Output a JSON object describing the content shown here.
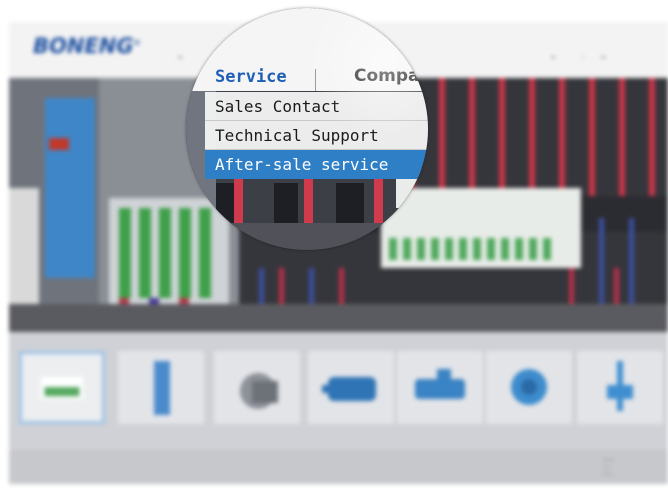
{
  "site": {
    "logo_text": "BONENG",
    "logo_mark": "®",
    "brand_color": "#1d4fa1"
  },
  "header": {
    "nav_service": "Service",
    "nav_company": "Company"
  },
  "dropdown": {
    "items": [
      {
        "label": "Sales Contact",
        "selected": false
      },
      {
        "label": "Technical Support",
        "selected": false
      },
      {
        "label": "After-sale service",
        "selected": true
      }
    ],
    "selected_color": "#2f7fc7"
  },
  "thumbnails": {
    "count": 7,
    "active_index": 0,
    "icons": [
      "terminal-block-icon",
      "power-module-icon",
      "servo-motor-icon",
      "blue-motor-icon",
      "blue-gearbox-icon",
      "planetary-gear-icon",
      "worm-jack-icon"
    ]
  }
}
